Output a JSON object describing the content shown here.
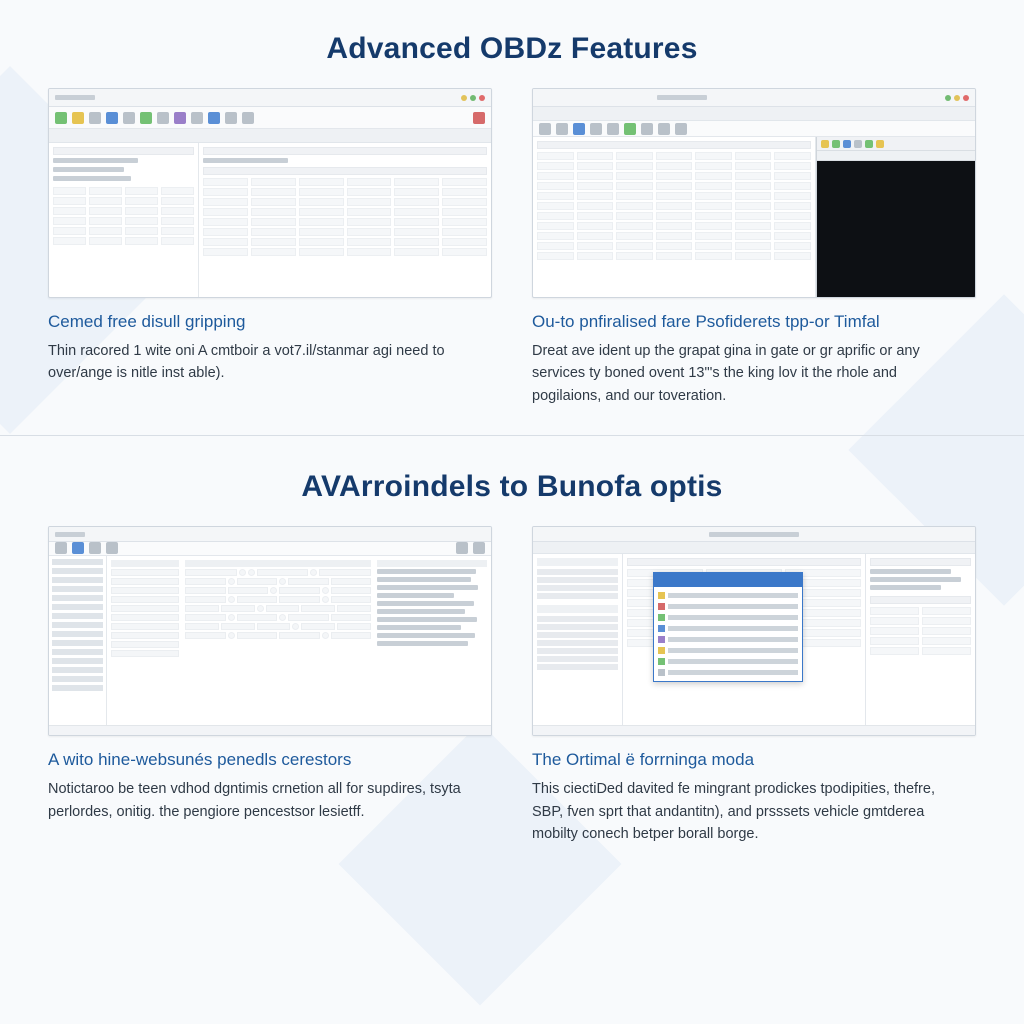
{
  "section1": {
    "title": "Advanced OBDz Features",
    "cards": [
      {
        "title": "Cemed free disull gripping",
        "desc": "Thin racored 1 wite oni A cmtboir a vot7.il/stanmar agi need to over/ange is nitle inst able)."
      },
      {
        "title": "Ou-to pnfiralised fare Psofiderets tpp-or Timfal",
        "desc": "Dreat ave ident up the grapat gina in gate or gr aprific or any services ty boned ovent 13\"'s the king lov it the rhole and pogilaions, and our toveration."
      }
    ]
  },
  "section2": {
    "title": "AVArroindels to Bunofa optis",
    "cards": [
      {
        "title": "A wito hine-websunés penedls cerestors",
        "desc": "Notictaroo be teen vdhod dgntimis crnetion all for supdires, tsyta perlordes, onitig. the pengiore pencestsor lesietff."
      },
      {
        "title": "The Ortimal ë forrninga moda",
        "desc": "This ciectiDed davited fe mingrant prodickes tpodipities, thefre, SBP, fven sprt that andantitn), and prsssets vehicle gmtderea mobilty conech betper borall borge."
      }
    ]
  }
}
